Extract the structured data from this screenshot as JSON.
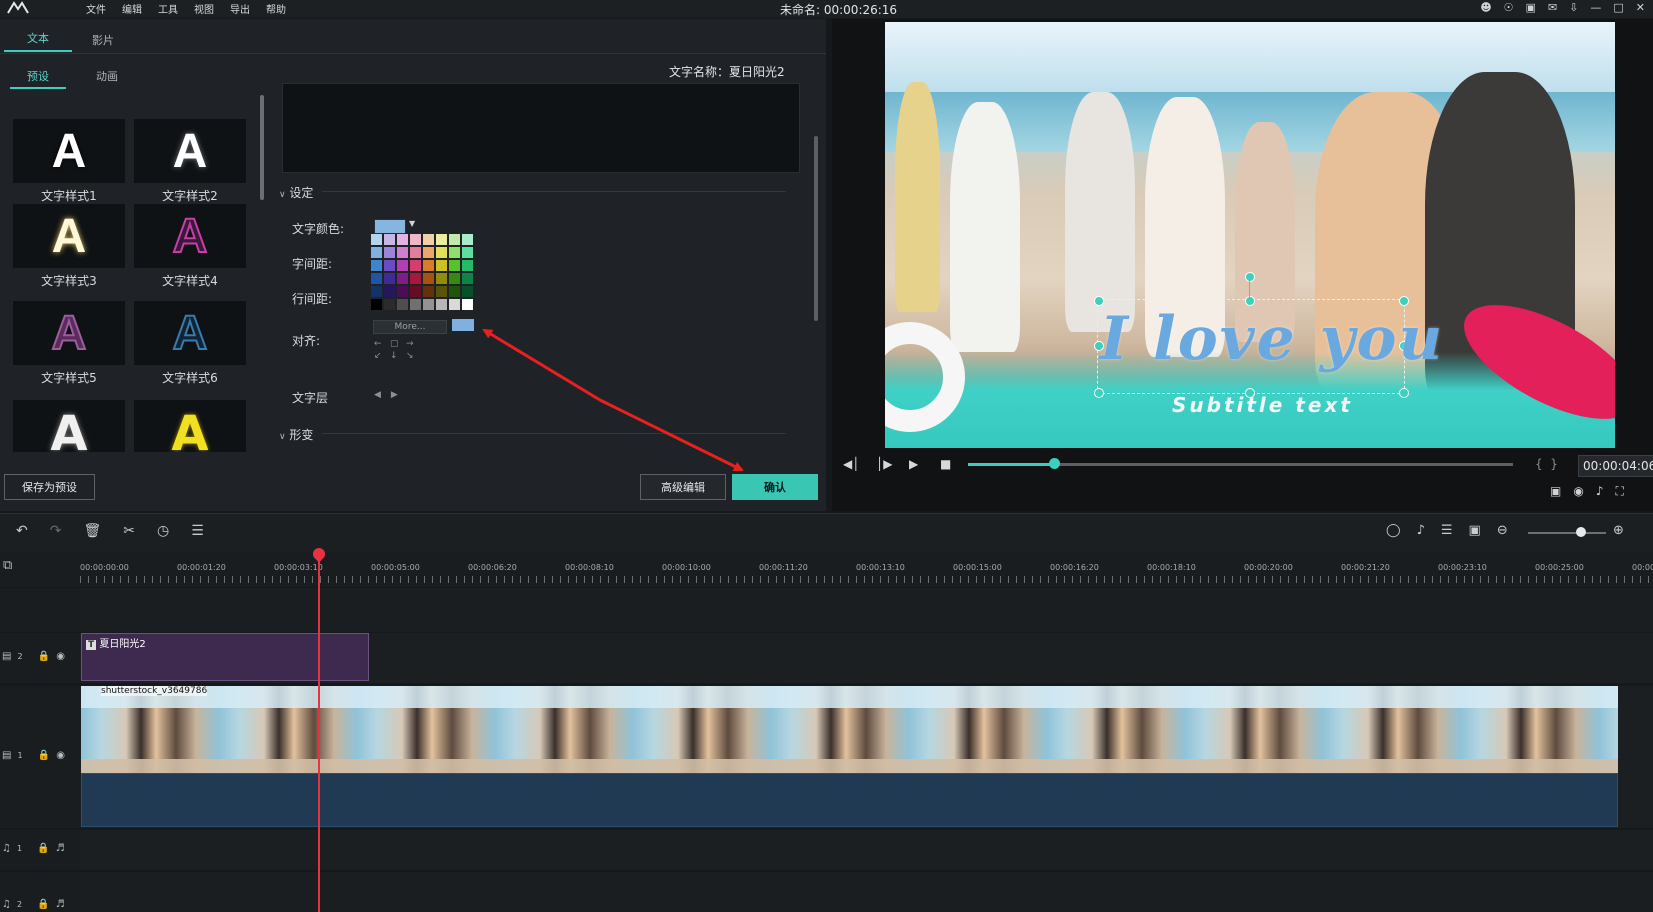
{
  "menubar": {
    "logo": "",
    "items": [
      "文件",
      "编辑",
      "工具",
      "视图",
      "导出",
      "帮助"
    ],
    "window_title": "未命名: 00:00:26:16"
  },
  "tabs": {
    "text": "文本",
    "film": "影片"
  },
  "subtabs": {
    "preset": "预设",
    "animation": "动画"
  },
  "presets": [
    {
      "label": "文字样式1",
      "color": "#ffffff",
      "glow": "#000000"
    },
    {
      "label": "文字样式2",
      "color": "#ffffff",
      "glow": "#6f7478"
    },
    {
      "label": "文字样式3",
      "color": "#fff8d8",
      "glow": "#e6c46a"
    },
    {
      "label": "文字样式4",
      "color": "#3a1838",
      "glow": "#c73ea8"
    },
    {
      "label": "文字样式5",
      "color": "#5b2b5b",
      "glow": "#9b5ca0"
    },
    {
      "label": "文字样式6",
      "color": "#0f2537",
      "glow": "#3d7aa8"
    },
    {
      "label": "",
      "color": "#f0f0f0",
      "glow": "#888888"
    },
    {
      "label": "",
      "color": "#f0e020",
      "glow": "#a89000"
    }
  ],
  "text_name": "文字名称：夏日阳光2",
  "settings": {
    "section": "设定",
    "color_label": "文字颜色:",
    "spacing_label": "字间距:",
    "line_spacing_label": "行间距:",
    "align_label": "对齐:",
    "layer_label": "文字层",
    "more_label": "More...",
    "transform_section": "形变",
    "color_value": "#86b6e0"
  },
  "buttons": {
    "save_preset": "保存为预设",
    "advanced_edit": "高级编辑",
    "confirm": "确认"
  },
  "preview": {
    "main_text": "I love you",
    "subtitle_text": "Subtitle text",
    "timecode": "00:00:04:06",
    "progress": 0.16
  },
  "timeline": {
    "ruler": [
      "00:00:00:00",
      "00:00:01:20",
      "00:00:03:10",
      "00:00:05:00",
      "00:00:06:20",
      "00:00:08:10",
      "00:00:10:00",
      "00:00:11:20",
      "00:00:13:10",
      "00:00:15:00",
      "00:00:16:20",
      "00:00:18:10",
      "00:00:20:00",
      "00:00:21:20",
      "00:00:23:10",
      "00:00:25:00",
      "00:00:"
    ],
    "title_clip": "夏日阳光2",
    "video_clip": "shutterstock_v3649786",
    "tracks": [
      {
        "label": "2",
        "type": "title"
      },
      {
        "label": "1",
        "type": "video"
      },
      {
        "label": "1",
        "type": "audio"
      },
      {
        "label": "2",
        "type": "audio"
      }
    ]
  }
}
